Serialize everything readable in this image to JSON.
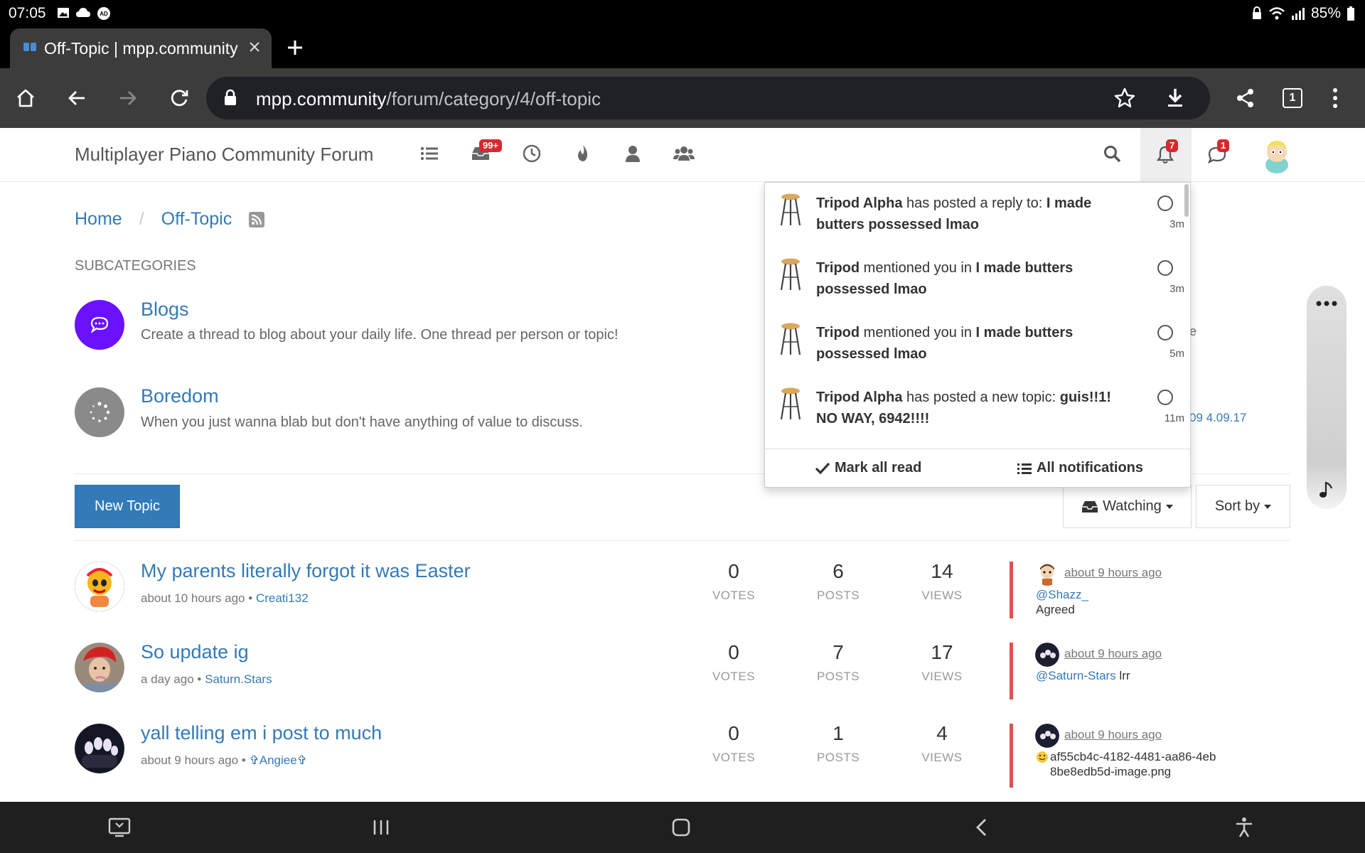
{
  "status_bar": {
    "time": "07:05",
    "battery": "85%"
  },
  "browser": {
    "tab_title": "Off-Topic | mpp.community",
    "url_host": "mpp.community",
    "url_path": "/forum/category/4/off-topic",
    "tab_count": "1"
  },
  "forum": {
    "brand": "Multiplayer Piano Community Forum",
    "unread_badge": "99+",
    "notif_badge": "7",
    "chat_badge": "1"
  },
  "breadcrumb": {
    "home": "Home",
    "sep": "/",
    "current": "Off-Topic"
  },
  "subcategories": {
    "heading": "SUBCATEGORIES",
    "items": [
      {
        "name": "Blogs",
        "desc": "Create a thread to blog about your daily life. One thread per person or topic!",
        "color": "#6a11ff"
      },
      {
        "name": "Boredom",
        "desc": "When you just wanna blab but don't have anything of value to discuss.",
        "color": "#8a8a8a"
      }
    ],
    "side_frag_1": "e",
    "side_frag_2": "09 4.09.17"
  },
  "actions": {
    "new_topic": "New Topic",
    "watching": "Watching",
    "sort_by": "Sort by"
  },
  "stat_labels": {
    "votes": "VOTES",
    "posts": "POSTS",
    "views": "VIEWS"
  },
  "topics": [
    {
      "title": "My parents literally forgot it was Easter",
      "time": "about 10 hours ago",
      "dot": "•",
      "author": "Creati132",
      "votes": "0",
      "posts": "6",
      "views": "14",
      "teaser_time": "about 9 hours ago",
      "teaser_user": "@Shazz_",
      "teaser_text": "Agreed"
    },
    {
      "title": "So update ig",
      "time": "a day ago",
      "dot": "•",
      "author": "Saturn.Stars",
      "votes": "0",
      "posts": "7",
      "views": "17",
      "teaser_time": "about 9 hours ago",
      "teaser_user": "@Saturn-Stars",
      "teaser_text": "lrr"
    },
    {
      "title": "yall telling em i post to much",
      "time": "about 9 hours ago",
      "dot": "•",
      "author": "✞Angiee✞",
      "votes": "0",
      "posts": "1",
      "views": "4",
      "teaser_time": "about 9 hours ago",
      "teaser_user": "",
      "teaser_text": "af55cb4c-4182-4481-aa86-4eb8be8edb5d-image.png"
    }
  ],
  "notifications": {
    "items": [
      {
        "user": "Tripod Alpha",
        "action": " has posted a reply to: ",
        "target": "I made butters possessed lmao",
        "time": "3m"
      },
      {
        "user": "Tripod",
        "action": " mentioned you in ",
        "target": "I made butters possessed lmao",
        "time": "3m"
      },
      {
        "user": "Tripod",
        "action": " mentioned you in ",
        "target": "I made butters possessed lmao",
        "time": "5m"
      },
      {
        "user": "Tripod Alpha",
        "action": " has posted a new topic: ",
        "target": "guis!!1! NO WAY, 6942!!!!",
        "time": "11m"
      }
    ],
    "mark_all_read": "Mark all read",
    "all_notifications": "All notifications"
  }
}
